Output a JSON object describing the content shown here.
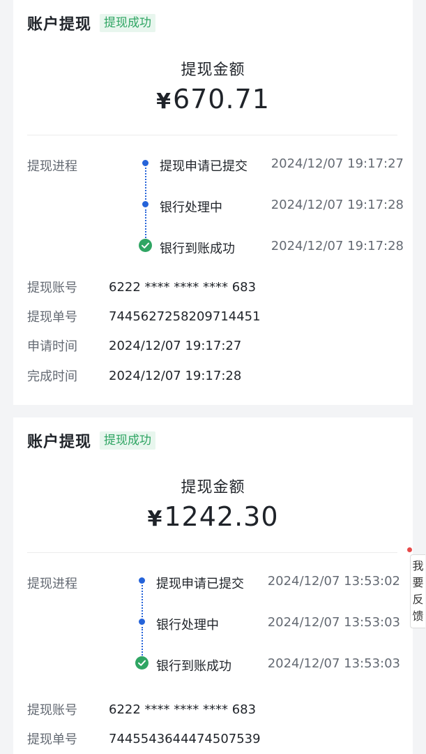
{
  "feedback": {
    "label": "我要反馈"
  },
  "records": [
    {
      "title": "账户提现",
      "status": "提现成功",
      "amount_label": "提现金额",
      "currency_symbol": "¥",
      "amount": "670.71",
      "progress_label": "提现进程",
      "steps": [
        {
          "name": "提现申请已提交",
          "time": "2024/12/07 19:17:27"
        },
        {
          "name": "银行处理中",
          "time": "2024/12/07 19:17:28"
        },
        {
          "name": "银行到账成功",
          "time": "2024/12/07 19:17:28"
        }
      ],
      "info": [
        {
          "label": "提现账号",
          "value": "6222 **** **** **** 683"
        },
        {
          "label": "提现单号",
          "value": "7445627258209714451"
        },
        {
          "label": "申请时间",
          "value": "2024/12/07 19:17:27"
        },
        {
          "label": "完成时间",
          "value": "2024/12/07 19:17:28"
        }
      ]
    },
    {
      "title": "账户提现",
      "status": "提现成功",
      "amount_label": "提现金额",
      "currency_symbol": "¥",
      "amount": "1242.30",
      "progress_label": "提现进程",
      "steps": [
        {
          "name": "提现申请已提交",
          "time": "2024/12/07 13:53:02"
        },
        {
          "name": "银行处理中",
          "time": "2024/12/07 13:53:03"
        },
        {
          "name": "银行到账成功",
          "time": "2024/12/07 13:53:03"
        }
      ],
      "info": [
        {
          "label": "提现账号",
          "value": "6222 **** **** **** 683"
        },
        {
          "label": "提现单号",
          "value": "7445543644474507539"
        }
      ]
    }
  ],
  "colors": {
    "success_green": "#2fa563",
    "success_bg": "#e8f6ee",
    "progress_blue": "#2563d9"
  }
}
